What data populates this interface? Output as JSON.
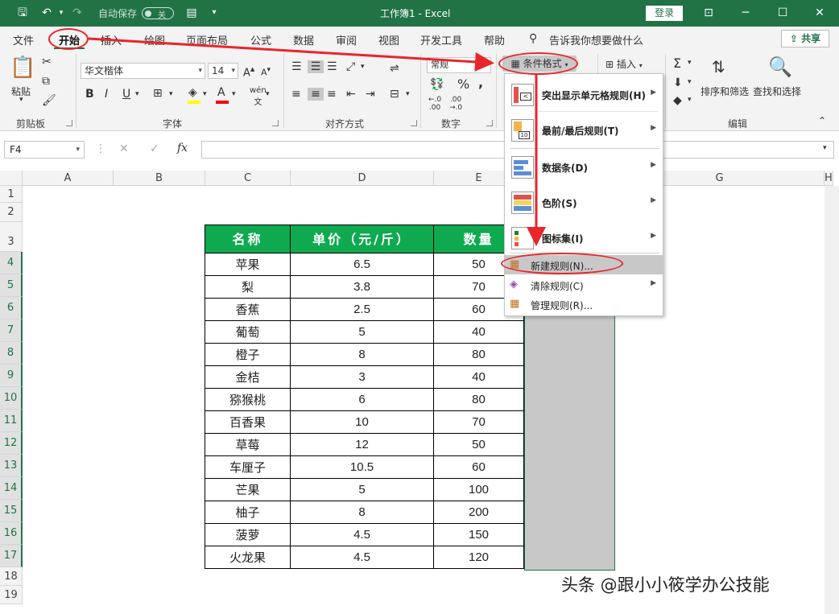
{
  "titlebar": {
    "autosave_label": "自动保存",
    "autosave_state": "关",
    "doc_title": "工作簿1  -  Excel",
    "login_label": "登录"
  },
  "tabs": [
    "文件",
    "开始",
    "插入",
    "绘图",
    "页面布局",
    "公式",
    "数据",
    "审阅",
    "视图",
    "开发工具",
    "帮助"
  ],
  "tell_me": "告诉我你想要做什么",
  "share_label": "共享",
  "ribbon": {
    "paste_label": "粘贴",
    "clipboard_label": "剪贴板",
    "font_name": "华文楷体",
    "font_size": "14",
    "font_group_label": "字体",
    "align_group_label": "对齐方式",
    "number_format": "常规",
    "number_group_label": "数字",
    "cond_format_label": "条件格式",
    "insert_label": "插入",
    "sort_filter_label": "排序和筛选",
    "find_select_label": "查找和选择",
    "editing_group_label": "编辑"
  },
  "formula_bar": {
    "name_box": "F4",
    "fx": "fx"
  },
  "columns": [
    "A",
    "B",
    "C",
    "D",
    "E",
    "F",
    "G",
    "H"
  ],
  "rows": [
    "1",
    "2",
    "3",
    "4",
    "5",
    "6",
    "7",
    "8",
    "9",
    "10",
    "11",
    "12",
    "13",
    "14",
    "15",
    "16",
    "17",
    "18",
    "19"
  ],
  "table": {
    "headers": [
      "名称",
      "单价（元/斤）",
      "数量"
    ],
    "rows": [
      [
        "苹果",
        "6.5",
        "50"
      ],
      [
        "梨",
        "3.8",
        "70"
      ],
      [
        "香蕉",
        "2.5",
        "60"
      ],
      [
        "葡萄",
        "5",
        "40"
      ],
      [
        "橙子",
        "8",
        "80"
      ],
      [
        "金桔",
        "3",
        "40"
      ],
      [
        "猕猴桃",
        "6",
        "80"
      ],
      [
        "百香果",
        "10",
        "70"
      ],
      [
        "草莓",
        "12",
        "50"
      ],
      [
        "车厘子",
        "10.5",
        "60"
      ],
      [
        "芒果",
        "5",
        "100"
      ],
      [
        "柚子",
        "8",
        "200"
      ],
      [
        "菠萝",
        "4.5",
        "150"
      ],
      [
        "火龙果",
        "4.5",
        "120"
      ]
    ]
  },
  "menu": {
    "items": [
      {
        "label": "突出显示单元格规则(H)"
      },
      {
        "label": "最前/最后规则(T)"
      },
      {
        "label": "数据条(D)"
      },
      {
        "label": "色阶(S)"
      },
      {
        "label": "图标集(I)"
      },
      {
        "label": "新建规则(N)..."
      },
      {
        "label": "清除规则(C)"
      },
      {
        "label": "管理规则(R)..."
      }
    ]
  },
  "watermark": "头条 @跟小小筱学办公技能"
}
